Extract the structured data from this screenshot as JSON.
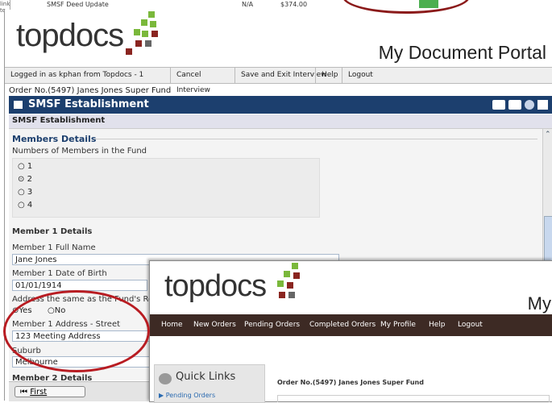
{
  "background_window": {
    "row_text": "SMSF Deed Update",
    "row_na": "N/A",
    "row_amount": "$374.00",
    "side_text": "link to"
  },
  "portal": {
    "logo_text": "topdocs",
    "title": "My Document Portal",
    "toolbar": {
      "logged_in": "Logged in as kphan from Topdocs - 1",
      "cancel": "Cancel Interview",
      "save_exit": "Save and Exit Interview",
      "help": "Help",
      "logout": "Logout"
    },
    "order_line": "Order No.(5497) Janes Jones Super Fund",
    "header_title": "SMSF Establishment",
    "sub_header": "SMSF Establishment",
    "members_section": "Members Details",
    "members_question": "Numbers of Members in the Fund",
    "member_options": [
      "1",
      "2",
      "3",
      "4"
    ],
    "member_selected": "2",
    "member1_title": "Member 1 Details",
    "name_label": "Member 1 Full Name",
    "name_value": "Jane Jones",
    "dob_label": "Member 1 Date of Birth",
    "dob_value": "01/01/1914",
    "address_same_label": "Address the same as the Fund's Registered Office?",
    "yes": "Yes",
    "no": "No",
    "street_label": "Member 1 Address - Street",
    "street_value": "123 Meeting Address",
    "suburb_label": "Suburb",
    "suburb_value": "Melbourne",
    "member2_title": "Member 2 Details",
    "first_button": "First"
  },
  "front_window": {
    "logo_text": "topdocs",
    "title_partial": "My",
    "nav": [
      "Home",
      "New Orders",
      "Pending Orders",
      "Completed Orders",
      "My Profile",
      "Help",
      "Logout"
    ],
    "quick_links": "Quick Links",
    "ql_item": "Pending Orders",
    "order_line": "Order No.(5497) Janes Jones Super Fund"
  },
  "colors": {
    "header_blue": "#1c3f6e",
    "highlight_red": "#b81c22",
    "nav_brown": "#3d2a24",
    "logo_green": "#7ab83b"
  }
}
